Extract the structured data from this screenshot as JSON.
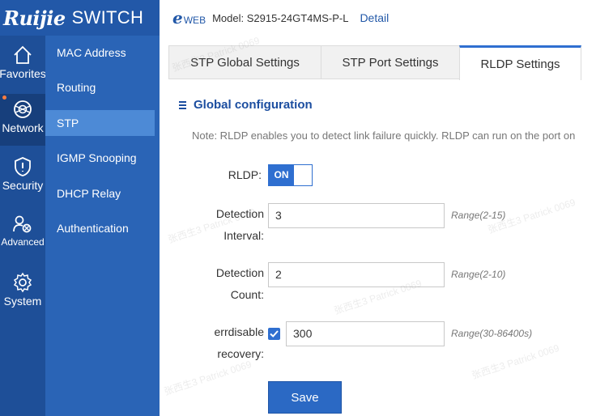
{
  "brand": {
    "logo": "Ruijie",
    "product": "SWITCH"
  },
  "header": {
    "eweb_e": "e",
    "eweb_rest": "WEB",
    "model": "Model: S2915-24GT4MS-P-L",
    "detail": "Detail"
  },
  "rail": [
    {
      "label": "Favorites",
      "icon": "home-icon",
      "active": false
    },
    {
      "label": "Network",
      "icon": "globe-icon",
      "active": true
    },
    {
      "label": "Security",
      "icon": "shield-icon",
      "active": false
    },
    {
      "label": "Advanced",
      "icon": "users-gear-icon",
      "active": false
    },
    {
      "label": "System",
      "icon": "gear-icon",
      "active": false
    }
  ],
  "submenu": [
    {
      "label": "MAC Address"
    },
    {
      "label": "Routing"
    },
    {
      "label": "STP",
      "active": true
    },
    {
      "label": "IGMP Snooping"
    },
    {
      "label": "DHCP Relay"
    },
    {
      "label": "Authentication"
    }
  ],
  "tabs": [
    {
      "label": "STP Global Settings"
    },
    {
      "label": "STP Port Settings"
    },
    {
      "label": "RLDP Settings",
      "active": true
    }
  ],
  "section": {
    "title": "Global configuration"
  },
  "note": "Note: RLDP enables you to detect link failure quickly. RLDP can run on the port on",
  "form": {
    "rldp_label": "RLDP:",
    "rldp_toggle": "ON",
    "interval_label_1": "Detection",
    "interval_label_2": "Interval:",
    "interval_value": "3",
    "interval_range": "Range(2-15)",
    "count_label_1": "Detection",
    "count_label_2": "Count:",
    "count_value": "2",
    "count_range": "Range(2-10)",
    "errdisable_label_1": "errdisable",
    "errdisable_label_2": "recovery:",
    "errdisable_checked": true,
    "errdisable_value": "300",
    "errdisable_range": "Range(30-86400s)"
  },
  "save_label": "Save",
  "watermark": "张西生3 Patrick 0069",
  "colors": {
    "brand_blue": "#2258a8",
    "rail": "#1e4f98",
    "submenu": "#2a64b6",
    "submenu_active": "#4d8ad6",
    "accent": "#2f6fd0",
    "notify_dot": "#ff7d3f"
  }
}
